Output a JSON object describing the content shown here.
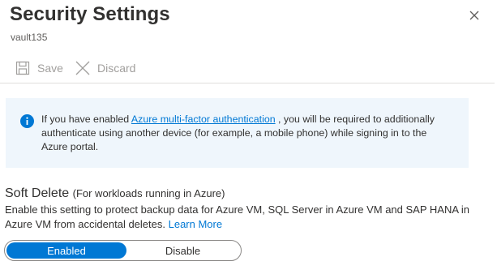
{
  "panel": {
    "title": "Security Settings",
    "subtitle": "vault135"
  },
  "toolbar": {
    "save_label": "Save",
    "discard_label": "Discard"
  },
  "info": {
    "text_before": "If you have enabled ",
    "link_text": "Azure multi-factor authentication",
    "text_after": " , you will be required to additionally authenticate using another device (for example, a mobile phone) while signing in to the Azure portal."
  },
  "soft_delete": {
    "heading": "Soft Delete",
    "heading_sub": "(For workloads running in Azure)",
    "description": "Enable this setting to protect backup data for Azure VM, SQL Server in Azure VM and SAP HANA in Azure VM from accidental deletes.",
    "learn_more": "Learn More",
    "options": [
      "Enabled",
      "Disable"
    ],
    "selected": "Enabled"
  },
  "colors": {
    "accent": "#0078d4",
    "info_background": "#eff6fc",
    "disabled_text": "#a19f9d"
  },
  "icons": {
    "close": "close-icon",
    "save": "save-icon",
    "discard": "discard-icon",
    "info": "info-icon"
  }
}
